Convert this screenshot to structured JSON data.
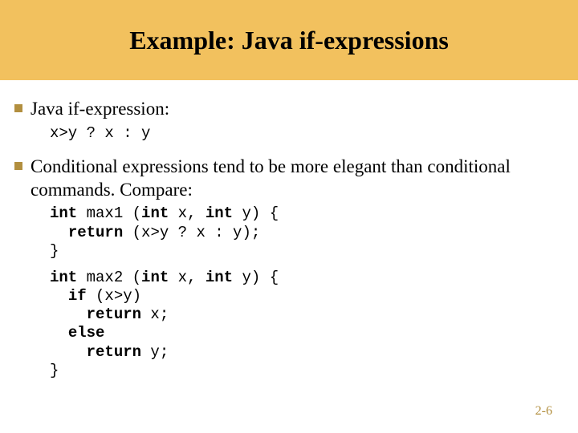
{
  "title": "Example: Java if-expressions",
  "bullets": {
    "b1": "Java if-expression:",
    "b2": "Conditional expressions tend to be more elegant than conditional commands. Compare:"
  },
  "code": {
    "c1": "x>y ? x : y",
    "kw": {
      "int": "int",
      "return": "return",
      "if": "if",
      "else": "else"
    },
    "max1": {
      "sig_mid1": " max1 (",
      "sig_mid2": " x, ",
      "sig_tail": " y) {",
      "ret_mid": " (x>y ? x : y);",
      "close": "}"
    },
    "max2": {
      "sig_mid1": " max2 (",
      "sig_mid2": " x, ",
      "sig_tail": " y) {",
      "if_cond": " (x>y)",
      "ret_x": " x;",
      "ret_y": " y;",
      "close": "}"
    }
  },
  "page": "2-6"
}
